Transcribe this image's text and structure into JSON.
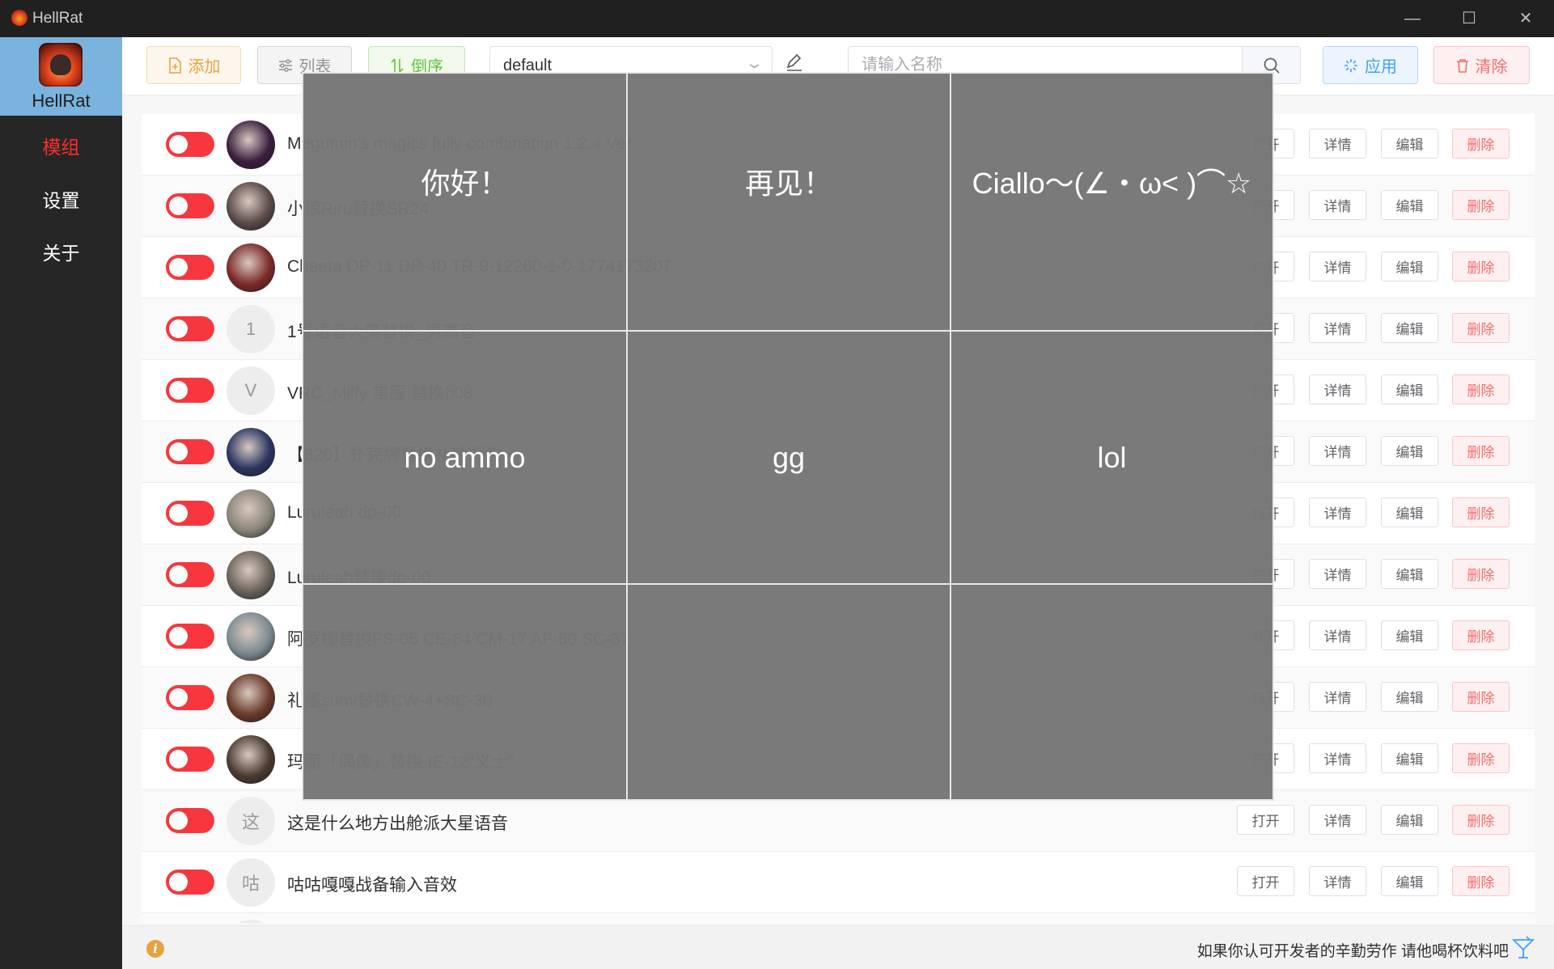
{
  "window": {
    "title": "HellRat",
    "minimize": "—",
    "maximize": "☐",
    "close": "✕"
  },
  "sidebar": {
    "brand": "HellRat",
    "nav": [
      {
        "label": "模组",
        "active": true
      },
      {
        "label": "设置",
        "active": false
      },
      {
        "label": "关于",
        "active": false
      }
    ]
  },
  "toolbar": {
    "add_label": "添加",
    "list_label": "列表",
    "reverse_label": "倒序",
    "profile_value": "default",
    "search_placeholder": "请输入名称",
    "apply_label": "应用",
    "clear_label": "清除"
  },
  "row_buttons": {
    "open": "打开",
    "detail": "详情",
    "edit": "编辑",
    "delete": "删除"
  },
  "mods": [
    {
      "name": "Megumin's magics fully combination 1.2.4 Ver",
      "avatar": "",
      "avatar_color": "#3a1f3e",
      "enabled": true
    },
    {
      "name": "小狼Riru替换SR24",
      "avatar": "",
      "avatar_color": "#5a4a48",
      "enabled": true
    },
    {
      "name": "Cheeta DP-11 DP-40 TR-9-12260-1-0-1774173207",
      "avatar": "",
      "avatar_color": "#7a2a28",
      "enabled": true
    },
    {
      "name": "1号语音大笑替换_男高音",
      "avatar": "1",
      "avatar_color": "",
      "enabled": true
    },
    {
      "name": "VRC_Milfy 常服 替换b08",
      "avatar": "V",
      "avatar_color": "",
      "enabled": true
    },
    {
      "name": "【826】扑克牌替换补给背包",
      "avatar": "",
      "avatar_color": "#2a3560",
      "enabled": true
    },
    {
      "name": "Luruleah dp-00",
      "avatar": "",
      "avatar_color": "#8a8478",
      "enabled": true
    },
    {
      "name": "Luruleah替换dp-00",
      "avatar": "",
      "avatar_color": "#6a625a",
      "enabled": true
    },
    {
      "name": "阿罗娜替换FS-05 CE-64 CM-17 AF-50 SC-37",
      "avatar": "",
      "avatar_color": "#7a8a90",
      "enabled": true
    },
    {
      "name": "礼墨sumi替换CW-4+SC-30",
      "avatar": "",
      "avatar_color": "#6a3a2a",
      "enabled": true
    },
    {
      "name": "玛丽「偶像」替换 IE-12“义士”",
      "avatar": "",
      "avatar_color": "#4a3a30",
      "enabled": true
    },
    {
      "name": "这是什么地方出舱派大星语音",
      "avatar": "这",
      "avatar_color": "",
      "enabled": true
    },
    {
      "name": "咕咕嘎嘎战备输入音效",
      "avatar": "咕",
      "avatar_color": "",
      "enabled": true
    },
    {
      "name": "",
      "avatar": "",
      "avatar_color": "",
      "enabled": true
    }
  ],
  "overlay": {
    "cells": [
      "你好！",
      "再见！",
      "Ciallo～(∠・ω< )⌒☆",
      "no ammo",
      "gg",
      "lol",
      "",
      "",
      ""
    ]
  },
  "footer": {
    "message": "如果你认可开发者的辛勤劳作 请他喝杯饮料吧"
  },
  "colors": {
    "accent_red": "#f7373d",
    "brand_blue": "#7ab3dd",
    "sidebar_bg": "#262626"
  }
}
